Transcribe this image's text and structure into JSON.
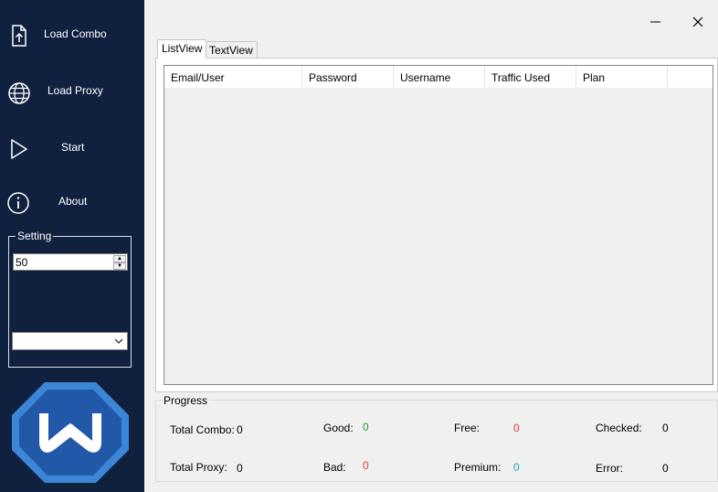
{
  "sidebar": {
    "items": [
      {
        "label": "Load Combo",
        "icon": "file-upload-icon"
      },
      {
        "label": "Load Proxy",
        "icon": "globe-icon"
      },
      {
        "label": "Start",
        "icon": "play-icon"
      },
      {
        "label": "About",
        "icon": "info-icon"
      }
    ],
    "setting": {
      "legend": "Setting",
      "threads_value": "50",
      "dropdown_value": ""
    },
    "logo_icon": "windscribe-logo"
  },
  "window": {
    "minimize_icon": "minimize-icon",
    "close_icon": "close-icon"
  },
  "tabs": [
    {
      "label": "ListView",
      "active": true
    },
    {
      "label": "TextView",
      "active": false
    }
  ],
  "listview": {
    "columns": [
      "Email/User",
      "Password",
      "Username",
      "Traffic Used",
      "Plan"
    ],
    "rows": []
  },
  "progress": {
    "legend": "Progress",
    "total_combo": {
      "label": "Total Combo:",
      "value": "0"
    },
    "total_proxy": {
      "label": "Total Proxy:",
      "value": "0"
    },
    "good": {
      "label": "Good:",
      "value": "0"
    },
    "bad": {
      "label": "Bad:",
      "value": "0"
    },
    "free": {
      "label": "Free:",
      "value": "0"
    },
    "premium": {
      "label": "Premium:",
      "value": "0"
    },
    "checked": {
      "label": "Checked:",
      "value": "0"
    },
    "error": {
      "label": "Error:",
      "value": "0"
    }
  },
  "colors": {
    "sidebar_bg": "#10213f",
    "good": "#2e9a2e",
    "bad": "#e23c3c",
    "free": "#e23c3c",
    "premium": "#21a9c7",
    "logo_outer": "#3b86d6",
    "logo_inner": "#2159a8"
  }
}
